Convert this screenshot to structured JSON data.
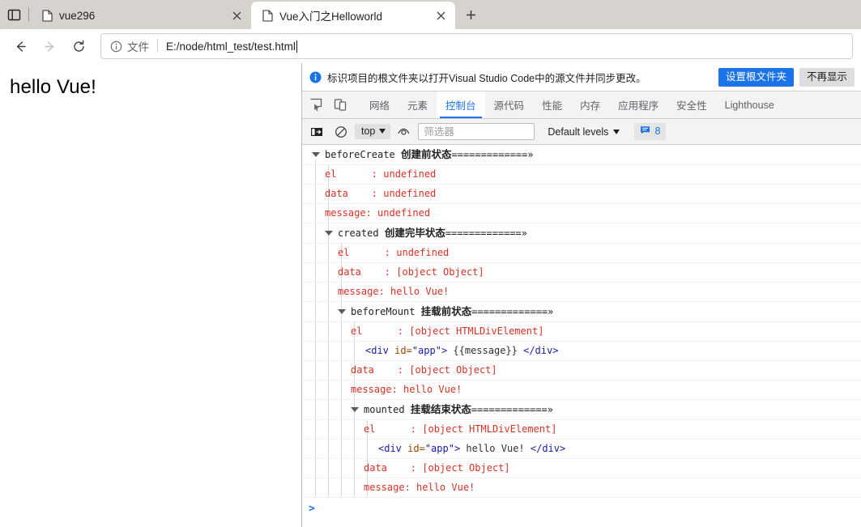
{
  "window": {
    "tabs": [
      {
        "title": "vue296",
        "active": false,
        "icon": "page-icon"
      },
      {
        "title": "Vue入门之Helloworld",
        "active": true,
        "icon": "page-icon"
      }
    ],
    "new_tab_label": "+",
    "tab_search_icon": "tab-list-icon"
  },
  "navbar": {
    "back_icon": "back-arrow-icon",
    "forward_icon": "forward-arrow-icon",
    "reload_icon": "reload-icon",
    "info_icon": "info-circle-icon",
    "scheme_label": "文件",
    "url": "E:/node/html_test/test.html"
  },
  "page": {
    "heading": "hello Vue!"
  },
  "infobar": {
    "icon": "info-circle-icon",
    "message": "标识项目的根文件夹以打开Visual Studio Code中的源文件并同步更改。",
    "primary_button": "设置根文件夹",
    "secondary_button": "不再显示"
  },
  "devtools": {
    "inspect_icon": "inspect-element-icon",
    "device_icon": "device-toolbar-icon",
    "tabs": [
      {
        "label": "网络",
        "active": false
      },
      {
        "label": "元素",
        "active": false
      },
      {
        "label": "控制台",
        "active": true
      },
      {
        "label": "源代码",
        "active": false
      },
      {
        "label": "性能",
        "active": false
      },
      {
        "label": "内存",
        "active": false
      },
      {
        "label": "应用程序",
        "active": false
      },
      {
        "label": "安全性",
        "active": false
      },
      {
        "label": "Lighthouse",
        "active": false
      }
    ],
    "accent_color": "#1a73e8"
  },
  "console_toolbar": {
    "sidebar_icon": "console-sidebar-icon",
    "clear_icon": "clear-console-icon",
    "context": "top",
    "eye_icon": "live-expression-eye-icon",
    "filter_placeholder": "筛选器",
    "filter_value": "",
    "levels_label": "Default levels",
    "message_badge_icon": "message-bubble-icon",
    "message_count": "8"
  },
  "console": {
    "prompt_symbol": ">",
    "messages": [
      {
        "type": "group",
        "depth": 0,
        "name": "beforeCreate",
        "zh": "创建前状态",
        "rule": "=============",
        "chevron": "»"
      },
      {
        "type": "log",
        "depth": 1,
        "text": "el      : undefined"
      },
      {
        "type": "log",
        "depth": 1,
        "text": "data    : undefined"
      },
      {
        "type": "log",
        "depth": 1,
        "text": "message: undefined"
      },
      {
        "type": "group",
        "depth": 1,
        "name": "created",
        "zh": "创建完毕状态",
        "rule": "=============",
        "chevron": "»"
      },
      {
        "type": "log",
        "depth": 2,
        "text": "el      : undefined"
      },
      {
        "type": "log",
        "depth": 2,
        "text": "data    : [object Object]"
      },
      {
        "type": "log",
        "depth": 2,
        "text": "message: hello Vue!"
      },
      {
        "type": "group",
        "depth": 2,
        "name": "beforeMount",
        "zh": "挂载前状态",
        "rule": "=============",
        "chevron": "»"
      },
      {
        "type": "log",
        "depth": 3,
        "text": "el      : [object HTMLDivElement]"
      },
      {
        "type": "dom",
        "depth": 3,
        "open_tag": "<div",
        "attr_name": " id=",
        "attr_value": "\"app\"",
        "open_close": ">",
        "content": " {{message}} ",
        "close_tag": "</div>"
      },
      {
        "type": "log",
        "depth": 3,
        "text": "data    : [object Object]"
      },
      {
        "type": "log",
        "depth": 3,
        "text": "message: hello Vue!"
      },
      {
        "type": "group",
        "depth": 3,
        "name": "mounted",
        "zh": "挂载结束状态",
        "rule": "=============",
        "chevron": "»"
      },
      {
        "type": "log",
        "depth": 4,
        "text": "el      : [object HTMLDivElement]"
      },
      {
        "type": "dom",
        "depth": 4,
        "open_tag": "<div",
        "attr_name": " id=",
        "attr_value": "\"app\"",
        "open_close": ">",
        "content": " hello Vue! ",
        "close_tag": "</div>"
      },
      {
        "type": "log",
        "depth": 4,
        "text": "data    : [object Object]"
      },
      {
        "type": "log",
        "depth": 4,
        "text": "message: hello Vue!"
      }
    ]
  }
}
